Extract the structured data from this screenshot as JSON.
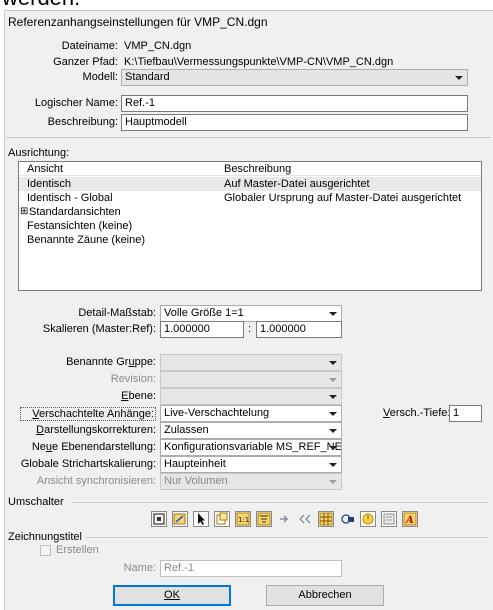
{
  "cutoff_text": "werden:",
  "dialog": {
    "title": "Referenzanhangseinstellungen für VMP_CN.dgn"
  },
  "file": {
    "name_label": "Dateiname:",
    "name_value": "VMP_CN.dgn",
    "path_label": "Ganzer Pfad:",
    "path_value": "K:\\Tiefbau\\Vermessungspunkte\\VMP-CN\\VMP_CN.dgn",
    "model_label": "Modell:",
    "model_value": "Standard"
  },
  "logical": {
    "name_label": "Logischer Name:",
    "name_value": "Ref.-1",
    "desc_label": "Beschreibung:",
    "desc_value": "Hauptmodell"
  },
  "orientation": {
    "label": "Ausrichtung:",
    "col_view": "Ansicht",
    "col_desc": "Beschreibung",
    "rows": [
      {
        "view": "Identisch",
        "desc": "Auf Master-Datei ausgerichtet"
      },
      {
        "view": "Identisch - Global",
        "desc": "Globaler Ursprung auf Master-Datei ausgerichtet"
      },
      {
        "view": "Standardansichten",
        "desc": "",
        "expander": "⊞"
      },
      {
        "view": "Festansichten (keine)",
        "desc": ""
      },
      {
        "view": "Benannte Zäune (keine)",
        "desc": ""
      }
    ]
  },
  "scale": {
    "detail_label": "Detail-Maßstab:",
    "detail_value": "Volle Größe 1=1",
    "ratio_label": "Skalieren (Master:Ref):",
    "ratio_master": "1.000000",
    "ratio_sep": ":",
    "ratio_ref": "1.000000"
  },
  "options": {
    "group_label": "Benannte Gruppe:",
    "group_value": "",
    "revision_label": "Revision:",
    "revision_value": "",
    "level_label": "Ebene:",
    "level_value": "",
    "nested_label": "Verschachtelte Anhänge:",
    "nested_value": "Live-Verschachtelung",
    "depth_label": "Versch.-Tiefe:",
    "depth_value": "1",
    "corrections_label": "Darstellungskorrekturen:",
    "corrections_value": "Zulassen",
    "newlevel_label": "Neue Ebenendarstellung:",
    "newlevel_value": "Konfigurationsvariable MS_REF_NEWLEV",
    "linestyle_label": "Globale Strichartskalierung:",
    "linestyle_value": "Haupteinheit",
    "sync_label": "Ansicht synchronisieren:",
    "sync_value": "Nur Volumen"
  },
  "toggles": {
    "label": "Umschalter",
    "icons": [
      "display-icon",
      "snap-icon",
      "locate-icon",
      "clip-icon",
      "scale-linestyle-icon",
      "treat-as-element-icon",
      "use-lights-icon",
      "ignore-icon",
      "raster-icon",
      "ref-display-icon",
      "lock-icon",
      "annotation-icon",
      "level-override-icon"
    ]
  },
  "drawing_title": {
    "label": "Zeichnungstitel",
    "create_label": "Erstellen",
    "name_label": "Name:",
    "name_value": "Ref.-1"
  },
  "buttons": {
    "ok": "OK",
    "cancel": "Abbrechen"
  },
  "colors": {
    "accent": "#0078d7",
    "background": "#f0f0f0"
  }
}
